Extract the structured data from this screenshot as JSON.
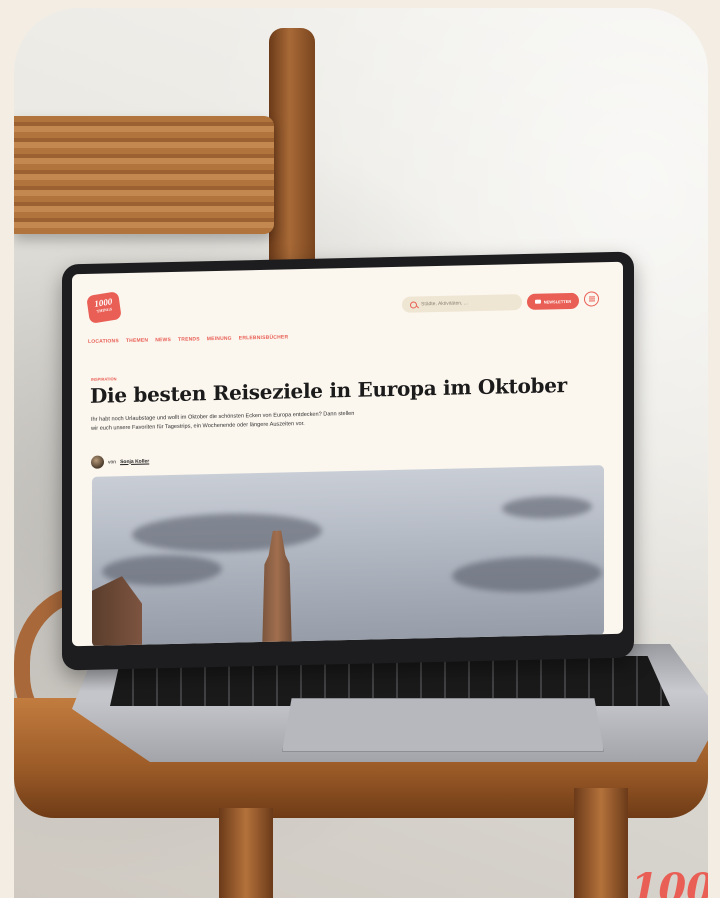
{
  "site": {
    "logo_text": "1000",
    "logo_sub": "THINGS",
    "search_placeholder": "Städte, Aktivitäten, ...",
    "newsletter_label": "NEWSLETTER",
    "nav": [
      "LOCATIONS",
      "THEMEN",
      "NEWS",
      "TRENDS",
      "MEINUNG",
      "ERLEBNISBÜCHER"
    ]
  },
  "article": {
    "category": "INSPIRATION",
    "title": "Die besten Reiseziele in Europa im Oktober",
    "lead": "Ihr habt noch Urlaubstage und wollt im Oktober die schönsten Ecken von Europa entdecken? Dann stellen wir euch unsere Favoriten für Tagestrips, ein Wochenende oder längere Auszeiten vor.",
    "author_prefix": "von",
    "author_name": "Sonja Koller"
  },
  "corner_logo_text": "100",
  "colors": {
    "accent": "#e95f55",
    "page_bg": "#fbf6ee",
    "search_bg": "#efe5d3"
  }
}
